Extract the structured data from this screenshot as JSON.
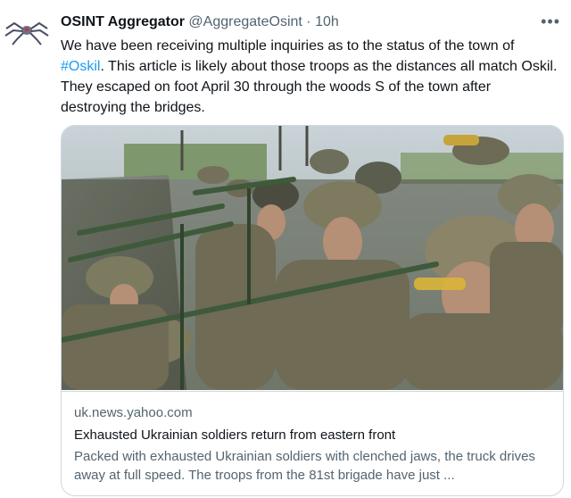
{
  "tweet": {
    "display_name": "OSINT Aggregator",
    "handle": "@AggregateOsint",
    "separator": "·",
    "time": "10h",
    "more_label": "•••",
    "avatar_icon": "spider-drone-icon",
    "text_part1": "We have been receiving multiple inquiries as to the status of the town of ",
    "hashtag": "#Oskil",
    "text_part2": ". This article is likely about those troops as the distances all match Oskil. They escaped on foot April 30 through the woods S of the town after destroying the bridges."
  },
  "card": {
    "image_icon": "soldiers-on-truck-photo",
    "domain": "uk.news.yahoo.com",
    "title": "Exhausted Ukrainian soldiers return from eastern front",
    "description": "Packed with exhausted Ukrainian soldiers with clenched jaws, the truck drives away at full speed. The troops from the 81st brigade have just ..."
  },
  "colors": {
    "link": "#1d9bf0",
    "secondary_text": "#536471",
    "border": "#cfd9de"
  }
}
